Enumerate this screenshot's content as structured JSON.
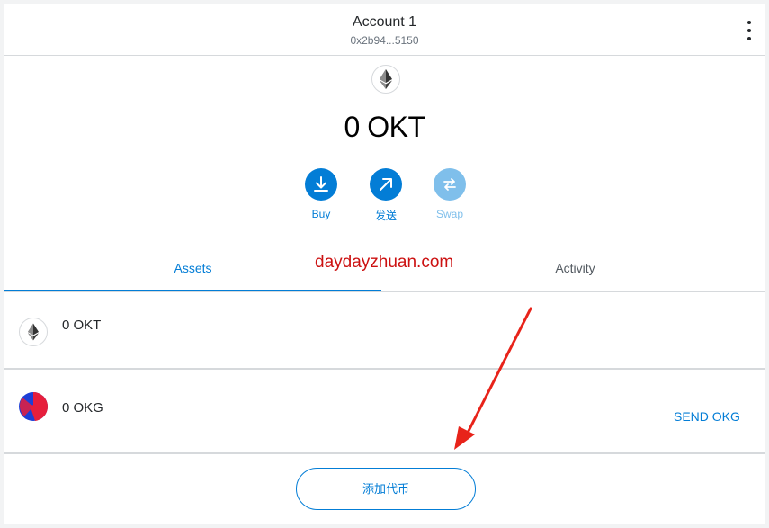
{
  "header": {
    "account_name": "Account 1",
    "account_address": "0x2b94...5150",
    "menu_icon": "kebab-menu-icon"
  },
  "balance": {
    "token_icon": "ethereum-icon",
    "amount_text": "0 OKT"
  },
  "actions": [
    {
      "label": "Buy",
      "icon": "download-icon",
      "enabled": true
    },
    {
      "label": "发送",
      "icon": "arrow-up-right-icon",
      "enabled": true
    },
    {
      "label": "Swap",
      "icon": "swap-icon",
      "enabled": false
    }
  ],
  "tabs": [
    {
      "label": "Assets",
      "active": true
    },
    {
      "label": "Activity",
      "active": false
    }
  ],
  "watermark": "daydayzhuan.com",
  "assets": [
    {
      "icon": "ethereum-icon",
      "amount": "0 OKT"
    },
    {
      "icon": "okg-token-icon",
      "amount": "0 OKG",
      "send_label": "SEND OKG"
    }
  ],
  "add_token_label": "添加代币",
  "colors": {
    "accent": "#037dd6",
    "accent_disabled": "#7fbfeb",
    "annotation_arrow": "#e8231a",
    "watermark": "#cc1111"
  }
}
